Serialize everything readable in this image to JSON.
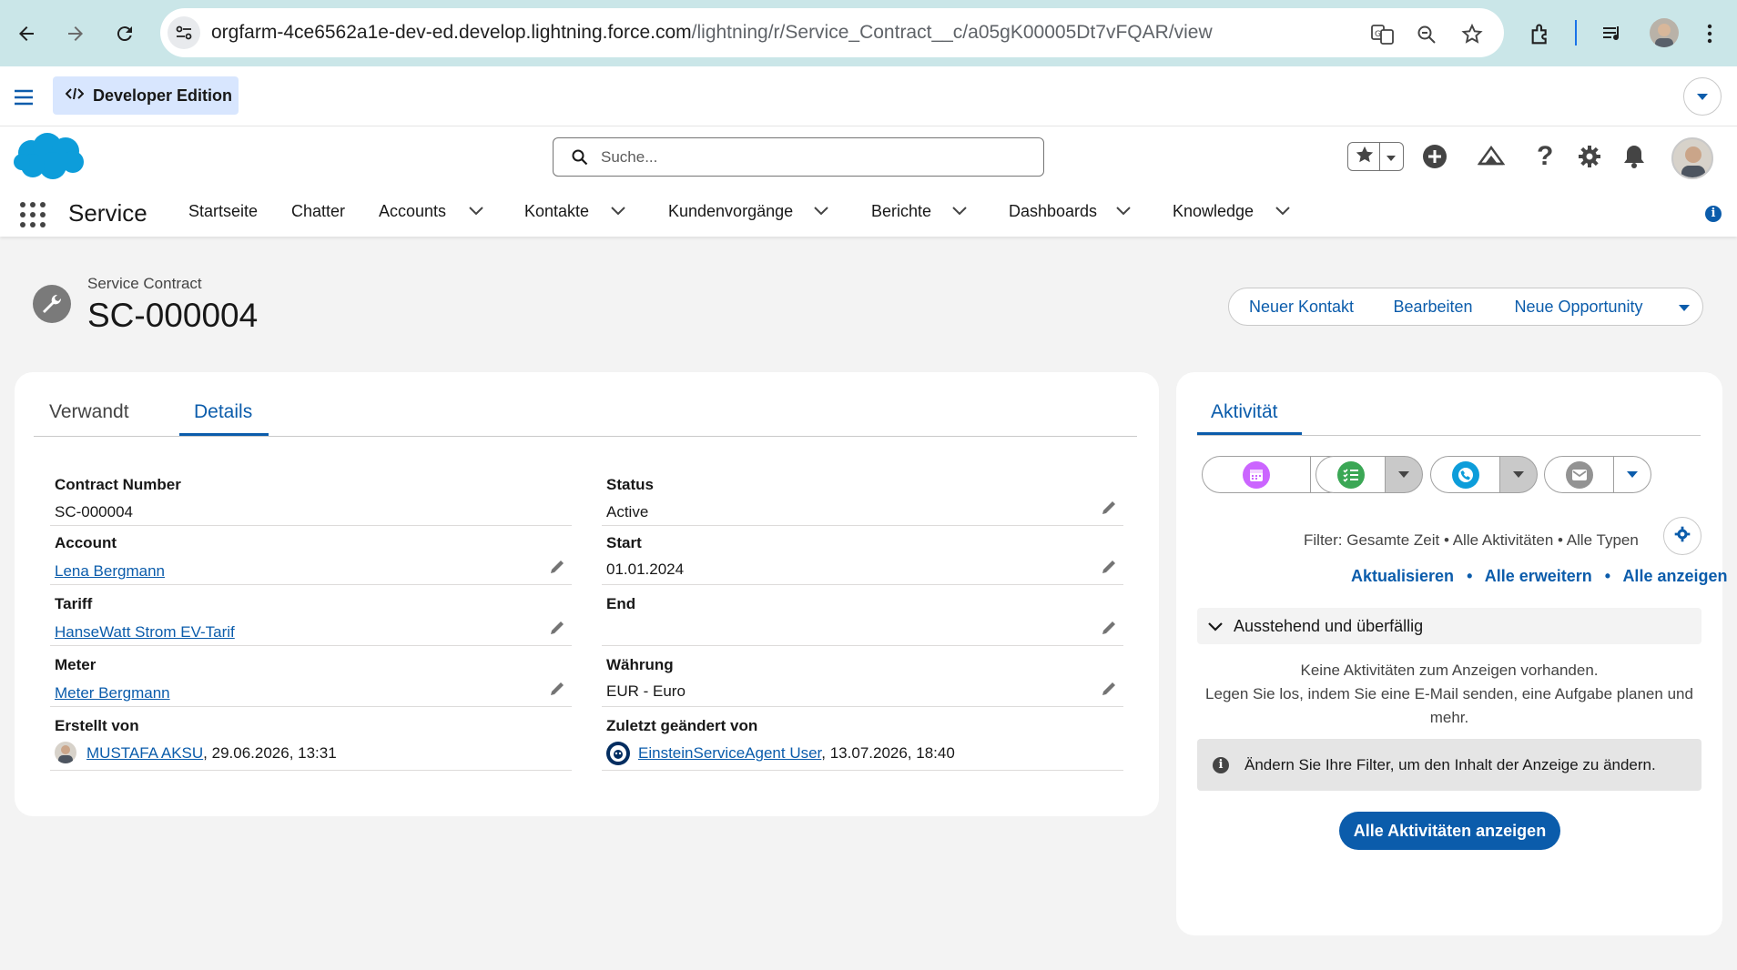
{
  "browser": {
    "url_domain": "orgfarm-4ce6562a1e-dev-ed.develop.lightning.force.com",
    "url_path": "/lightning/r/Service_Contract__c/a05gK00005Dt7vFQAR/view"
  },
  "devbar": {
    "edition_label": "Developer Edition"
  },
  "header": {
    "search_placeholder": "Suche...",
    "app_name": "Service",
    "nav": [
      "Startseite",
      "Chatter",
      "Accounts",
      "Kontakte",
      "Kundenvorgänge",
      "Berichte",
      "Dashboards",
      "Knowledge"
    ]
  },
  "record": {
    "object_label": "Service Contract",
    "title": "SC-000004",
    "actions": [
      "Neuer Kontakt",
      "Bearbeiten",
      "Neue Opportunity"
    ]
  },
  "tabs": {
    "related": "Verwandt",
    "details": "Details"
  },
  "fields": {
    "contract_number": {
      "label": "Contract Number",
      "value": "SC-000004"
    },
    "status": {
      "label": "Status",
      "value": "Active"
    },
    "account": {
      "label": "Account",
      "value": "Lena Bergmann"
    },
    "start": {
      "label": "Start",
      "value": "01.01.2024"
    },
    "tariff": {
      "label": "Tariff",
      "value": "HanseWatt Strom EV-Tarif"
    },
    "end": {
      "label": "End",
      "value": ""
    },
    "meter": {
      "label": "Meter",
      "value": "Meter Bergmann"
    },
    "currency": {
      "label": "Währung",
      "value": "EUR - Euro"
    },
    "created_by": {
      "label": "Erstellt von",
      "user": "MUSTAFA AKSU",
      "date": ", 29.06.2026, 13:31"
    },
    "modified_by": {
      "label": "Zuletzt geändert von",
      "user": "EinsteinServiceAgent User",
      "date": ", 13.07.2026, 18:40"
    }
  },
  "activity": {
    "tab": "Aktivität",
    "filter_text": "Filter: Gesamte Zeit • Alle Aktivitäten • Alle Typen",
    "links": [
      "Aktualisieren",
      "Alle erweitern",
      "Alle anzeigen"
    ],
    "section_title": "Ausstehend und überfällig",
    "empty_line1": "Keine Aktivitäten zum Anzeigen vorhanden.",
    "empty_line2": "Legen Sie los, indem Sie eine E-Mail senden, eine Aufgabe planen und mehr.",
    "info_text": "Ändern Sie Ihre Filter, um den Inhalt der Anzeige zu ändern.",
    "show_all_button": "Alle Aktivitäten anzeigen"
  },
  "colors": {
    "brand": "#0b5cab",
    "event": "#cb65ff",
    "task": "#3ba755",
    "call": "#0d9dda",
    "email": "#939393"
  }
}
